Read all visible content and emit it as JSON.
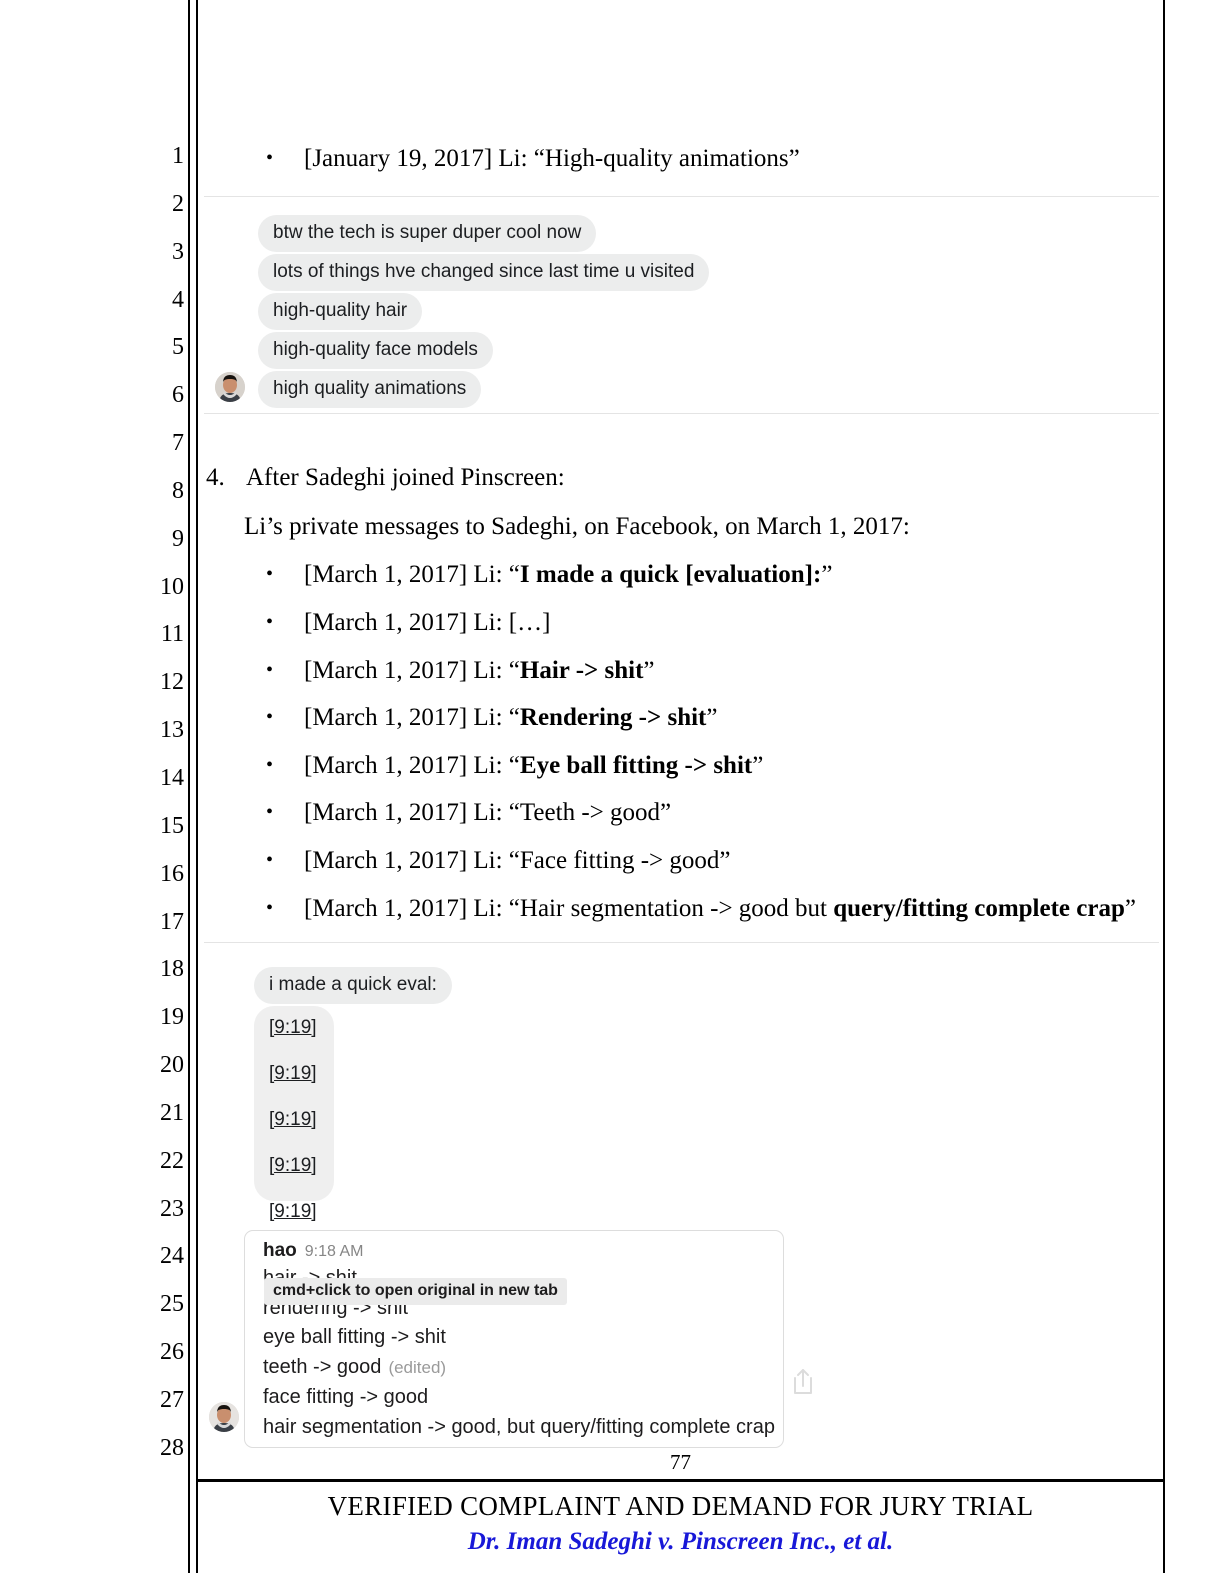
{
  "document": {
    "line_numbers": [
      "1",
      "2",
      "3",
      "4",
      "5",
      "6",
      "7",
      "8",
      "9",
      "10",
      "11",
      "12",
      "13",
      "14",
      "15",
      "16",
      "17",
      "18",
      "19",
      "20",
      "21",
      "22",
      "23",
      "24",
      "25",
      "26",
      "27",
      "28"
    ],
    "footer": {
      "page_number": "77",
      "title": "VERIFIED COMPLAINT AND DEMAND FOR JURY TRIAL",
      "case_caption": "Dr. Iman Sadeghi v. Pinscreen Inc., et al.",
      "case_caption_color": "#1818d8"
    }
  },
  "body": {
    "top_bullet": {
      "marker": "•",
      "prefix": "[January 19, 2017] Li: “High-quality animations”"
    },
    "numbered_item": {
      "marker": "4.",
      "text": "After Sadeghi joined Pinscreen:"
    },
    "intro_paragraph": "Li’s private messages to Sadeghi, on Facebook, on March 1, 2017:",
    "bullets": [
      {
        "marker": "•",
        "plain": "[March 1, 2017] Li: “",
        "bold": "I made a quick [evaluation]:",
        "tail": "”"
      },
      {
        "marker": "•",
        "plain": "[March 1, 2017] Li: […]",
        "bold": "",
        "tail": ""
      },
      {
        "marker": "•",
        "plain": "[March 1, 2017] Li: “",
        "bold": "Hair -> shit",
        "tail": "”"
      },
      {
        "marker": "•",
        "plain": "[March 1, 2017] Li: “",
        "bold": "Rendering -> shit",
        "tail": "”"
      },
      {
        "marker": "•",
        "plain": "[March 1, 2017] Li: “",
        "bold": "Eye ball fitting -> shit",
        "tail": "”"
      },
      {
        "marker": "•",
        "plain": "[March 1, 2017] Li: “Teeth -> good”",
        "bold": "",
        "tail": ""
      },
      {
        "marker": "•",
        "plain": "[March 1, 2017] Li: “Face fitting -> good”",
        "bold": "",
        "tail": ""
      },
      {
        "marker": "•",
        "plain": "[March 1, 2017] Li: “Hair segmentation -> good but ",
        "bold": "query/fitting complete crap",
        "tail": "”"
      }
    ]
  },
  "messenger_screenshot": {
    "messages": [
      "btw the tech is super duper cool now",
      "lots of things hve changed since last time u visited",
      "high-quality hair",
      "high-quality face models",
      "high quality animations"
    ],
    "avatar_name": "hao-avatar",
    "bubble_color": "#eceded"
  },
  "timestamp_screenshot": {
    "first_message": "i made a quick eval:",
    "timestamps": [
      "[9:19]",
      "[9:19]",
      "[9:19]",
      "[9:19]",
      "[9:19]"
    ],
    "bubble_color": "#efefef"
  },
  "slack_screenshot": {
    "user": "hao",
    "time": "9:18 AM",
    "lines": [
      {
        "text": "hair -> shit",
        "edited": ""
      },
      {
        "text": "rendering -> shit",
        "edited": ""
      },
      {
        "text": "eye ball fitting -> shit",
        "edited": ""
      },
      {
        "text": "teeth -> good",
        "edited": "(edited)"
      },
      {
        "text": "face fitting -> good",
        "edited": ""
      },
      {
        "text": "hair segmentation -> good, but query/fitting complete crap",
        "edited": ""
      }
    ],
    "tooltip": "cmd+click to open original in new tab",
    "share_icon": "share-icon",
    "avatar_name": "hao-avatar"
  }
}
